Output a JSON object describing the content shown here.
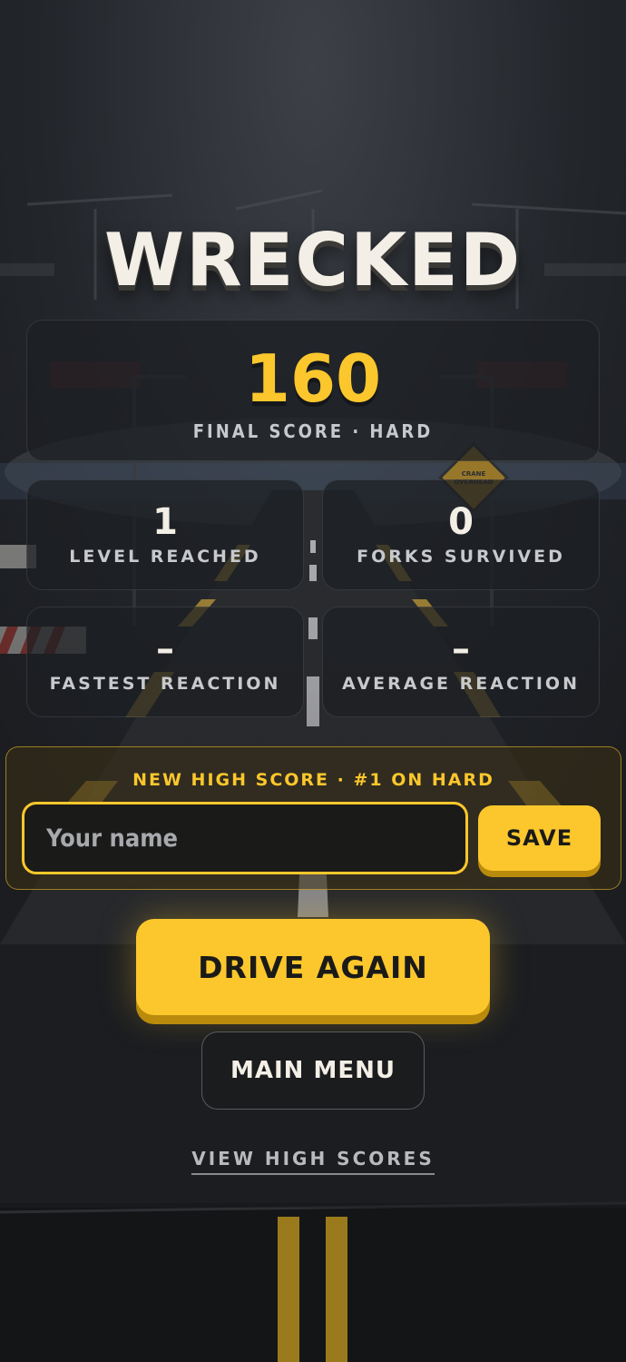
{
  "title": "WRECKED",
  "score": {
    "value": "160",
    "caption": "FINAL SCORE · HARD"
  },
  "stats": {
    "level": {
      "value": "1",
      "label": "LEVEL REACHED"
    },
    "forks": {
      "value": "0",
      "label": "FORKS SURVIVED"
    },
    "fastest": {
      "value": "–",
      "label": "FASTEST REACTION"
    },
    "average": {
      "value": "–",
      "label": "AVERAGE REACTION"
    }
  },
  "highscore": {
    "title": "NEW HIGH SCORE · #1 ON HARD",
    "name_placeholder": "Your name",
    "save_label": "SAVE"
  },
  "actions": {
    "drive_again": "DRIVE AGAIN",
    "main_menu": "MAIN MENU",
    "view_high_scores": "VIEW HIGH SCORES"
  },
  "scene": {
    "sign_text": "CRANE OVERHEAD"
  },
  "colors": {
    "accent": "#fcc72c",
    "background": "#1b1d21",
    "text": "#f3efe6"
  }
}
